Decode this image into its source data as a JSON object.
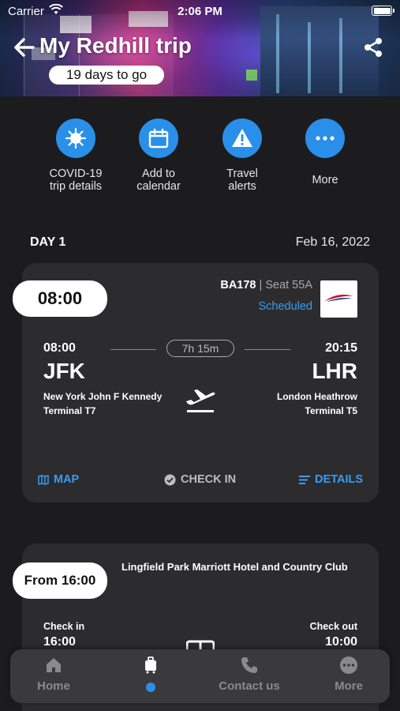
{
  "status_bar": {
    "carrier": "Carrier",
    "time": "2:06 PM"
  },
  "header": {
    "title": "My Redhill trip",
    "countdown": "19 days to go"
  },
  "quick_actions": [
    {
      "label": "COVID-19 trip details",
      "icon": "virus-icon"
    },
    {
      "label": "Add to calendar",
      "icon": "calendar-icon"
    },
    {
      "label": "Travel alerts",
      "icon": "warning-icon"
    },
    {
      "label": "More",
      "icon": "ellipsis-icon"
    }
  ],
  "day": {
    "label": "DAY 1",
    "date": "Feb 16, 2022"
  },
  "flight": {
    "time": "08:00",
    "flight_number": "BA178",
    "separator": "|",
    "seat": "Seat 55A",
    "status": "Scheduled",
    "departure": {
      "time": "08:00",
      "code": "JFK",
      "name": "New York John F Kennedy",
      "terminal": "Terminal T7"
    },
    "arrival": {
      "time": "20:15",
      "code": "LHR",
      "name": "London Heathrow",
      "terminal": "Terminal T5"
    },
    "duration": "7h 15m",
    "actions": {
      "map": "MAP",
      "checkin": "CHECK IN",
      "details": "DETAILS"
    }
  },
  "hotel": {
    "time": "From 16:00",
    "name": "Lingfield Park Marriott Hotel and Country Club",
    "check_in_label": "Check in",
    "check_in_time": "16:00",
    "check_out_label": "Check out",
    "check_out_time": "10:00"
  },
  "tabs": [
    {
      "label": "Home",
      "icon": "home-icon"
    },
    {
      "label": "",
      "icon": "luggage-icon",
      "active": true
    },
    {
      "label": "Contact us",
      "icon": "phone-icon"
    },
    {
      "label": "More",
      "icon": "ellipsis-icon"
    }
  ],
  "colors": {
    "accent": "#2a8fe8",
    "link": "#3a9cf0",
    "background": "#1c1c1e",
    "card": "#2c2c2e"
  }
}
